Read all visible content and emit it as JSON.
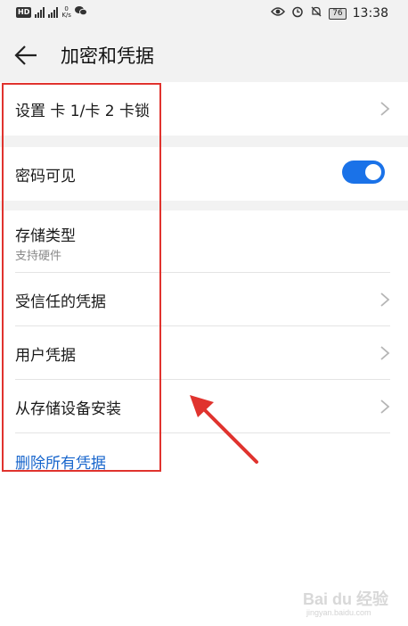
{
  "status_bar": {
    "hd_badge": "HD",
    "net_speed_value": "0",
    "net_speed_unit": "K/s",
    "battery": "76",
    "time": "13:38",
    "icons": [
      "hd-icon",
      "signal-icon",
      "wechat-icon",
      "eye-icon",
      "alarm-icon",
      "mute-icon",
      "battery-icon"
    ]
  },
  "header": {
    "title": "加密和凭据",
    "back_icon": "back-arrow-icon"
  },
  "settings": {
    "sim_lock": {
      "label": "设置 卡 1/卡 2 卡锁"
    },
    "password_visible": {
      "label": "密码可见",
      "enabled": true
    },
    "storage_type": {
      "label": "存储类型",
      "value": "支持硬件"
    },
    "trusted_credentials": {
      "label": "受信任的凭据"
    },
    "user_credentials": {
      "label": "用户凭据"
    },
    "install_from_storage": {
      "label": "从存储设备安装"
    },
    "clear_credentials": {
      "label": "删除所有凭据"
    }
  },
  "colors": {
    "accent": "#1a72e8",
    "link": "#1765cc",
    "annotation": "#e0332e",
    "background": "#f2f2f2"
  },
  "watermark": {
    "text": "Bai du 经验",
    "sub": "jingyan.baidu.com"
  }
}
